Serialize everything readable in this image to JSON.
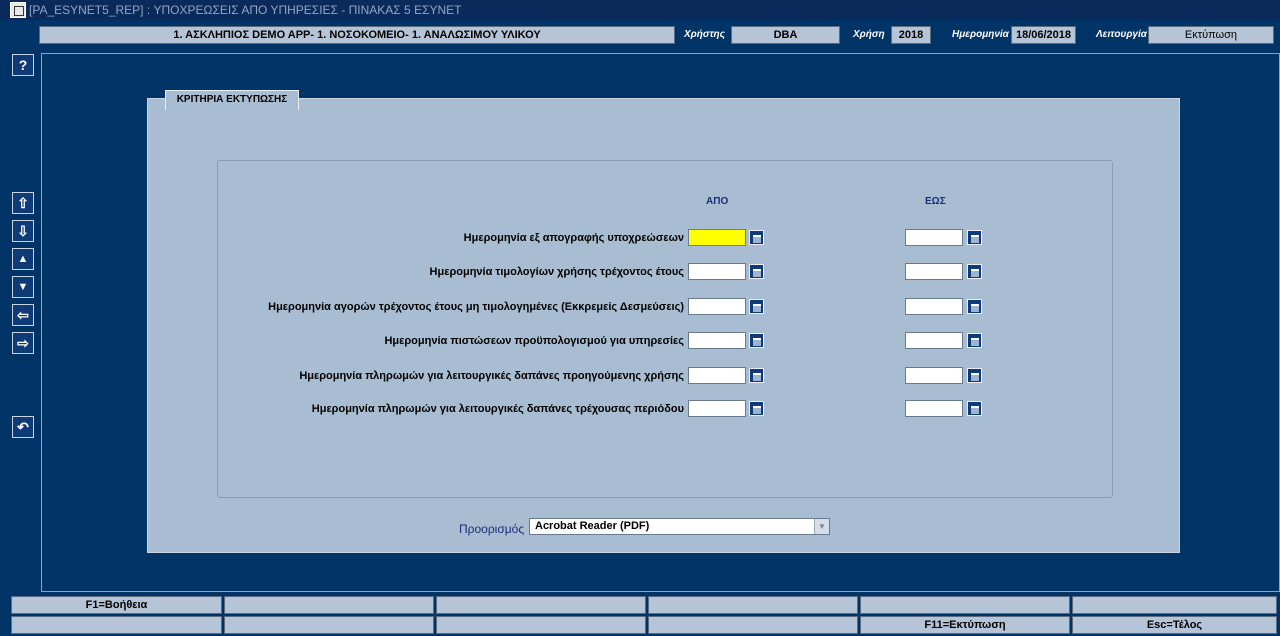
{
  "window": {
    "title": "[PA_ESYNET5_REP]  :  ΥΠΟΧΡΕΩΣΕΙΣ ΑΠΟ ΥΠΗΡΕΣΙΕΣ - ΠΙΝΑΚΑΣ 5 ΕΣΥΝΕΤ"
  },
  "header": {
    "organization": "1. ΑΣΚΛΗΠΙΟΣ DEMO APP- 1. ΝΟΣΟΚΟΜΕΙΟ- 1. ΑΝΑΛΩΣΙΜΟΥ ΥΛΙΚΟΥ",
    "user_label": "Χρήστης",
    "user_value": "DBA",
    "year_label": "Χρήση",
    "year_value": "2018",
    "date_label": "Ημερομηνία",
    "date_value": "18/06/2018",
    "function_label": "Λειτουργία",
    "function_value": "Εκτύπωση"
  },
  "toolbar": {
    "help": "?",
    "first": "⇧",
    "last": "⇩",
    "prev": "▲",
    "next": "▼",
    "left": "⇦",
    "right": "⇨",
    "back": "↶"
  },
  "criteria": {
    "tab_title": "ΚΡΙΤΗΡΙΑ ΕΚΤΥΠΩΣΗΣ",
    "from_header": "ΑΠΟ",
    "to_header": "ΕΩΣ",
    "rows": [
      {
        "label": "Ημερομηνία εξ απογραφής υποχρεώσεων",
        "from": "",
        "to": ""
      },
      {
        "label": "Ημερομηνία τιμολογίων χρήσης τρέχοντος έτους",
        "from": "",
        "to": ""
      },
      {
        "label": "Ημερομηνία αγορών τρέχοντος έτους μη τιμολογημένες (Εκκρεμείς Δεσμεύσεις)",
        "from": "",
        "to": ""
      },
      {
        "label": "Ημερομηνία πιστώσεων προϋπολογισμού για υπηρεσίες",
        "from": "",
        "to": ""
      },
      {
        "label": "Ημερομηνία πληρωμών για λειτουργικές δαπάνες προηγούμενης χρήσης",
        "from": "",
        "to": ""
      },
      {
        "label": "Ημερομηνία πληρωμών για λειτουργικές δαπάνες τρέχουσας περιόδου",
        "from": "",
        "to": ""
      }
    ],
    "destination_label": "Προορισμός",
    "destination_value": "Acrobat Reader (PDF)"
  },
  "function_keys": {
    "row1": [
      "F1=Βοήθεια",
      "",
      "",
      "",
      "",
      ""
    ],
    "row2": [
      "",
      "",
      "",
      "",
      "F11=Εκτύπωση",
      "Esc=Τέλος"
    ]
  },
  "colors": {
    "background": "#003366",
    "panel": "#a9bdd2",
    "active_field": "#ffff00"
  }
}
